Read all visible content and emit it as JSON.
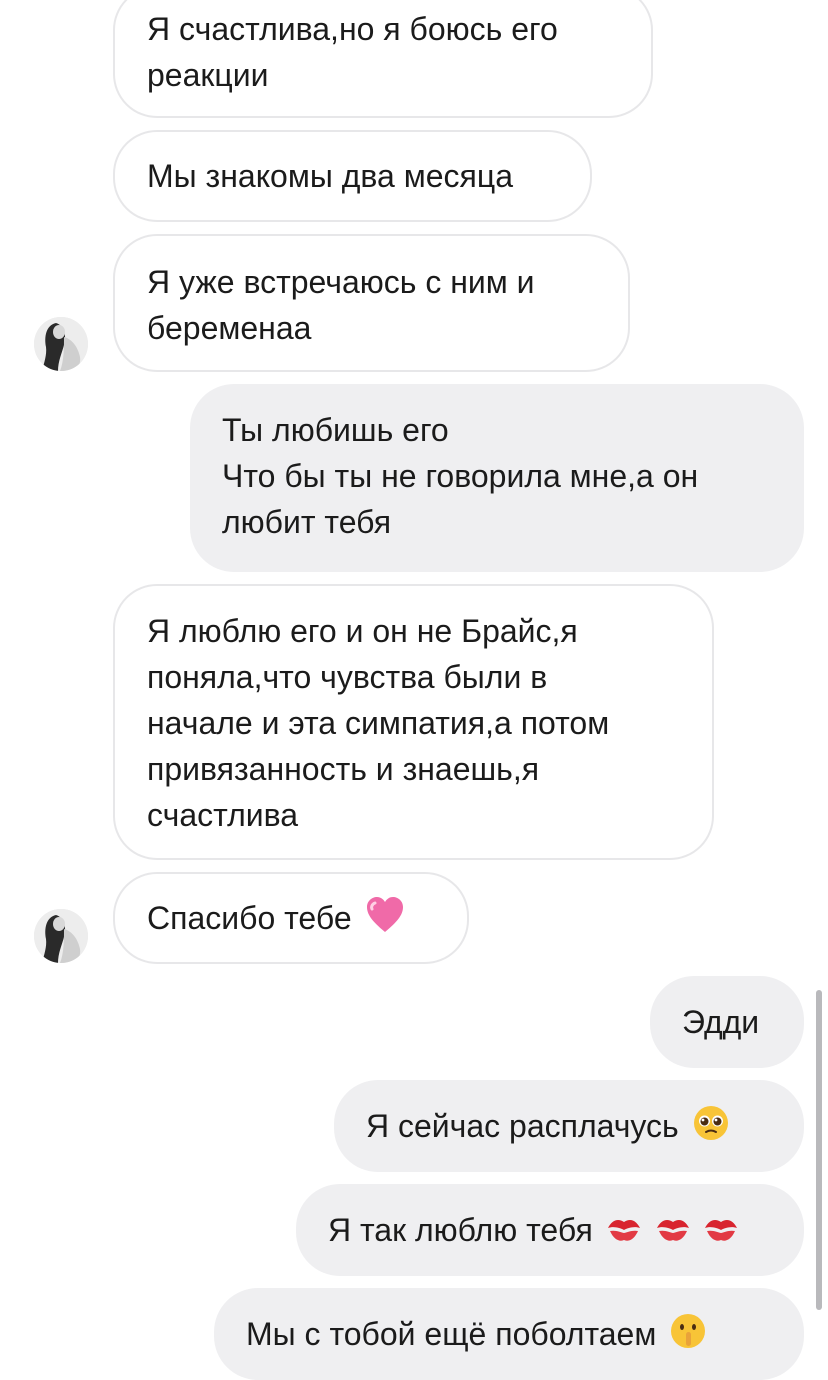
{
  "messages": [
    {
      "side": "in",
      "lines": [
        "Я счастлива,но я боюсь его",
        "реакции"
      ]
    },
    {
      "side": "in",
      "lines": [
        "Мы знакомы два месяца"
      ]
    },
    {
      "side": "in",
      "lines": [
        "Я уже встречаюсь с ним и",
        "беременаа"
      ]
    },
    {
      "side": "out",
      "lines": [
        "Ты любишь его",
        "Что бы ты не говорила мне,а он",
        "любит тебя"
      ]
    },
    {
      "side": "in",
      "lines": [
        "Я люблю его и он не Брайс,я",
        "поняла,что чувства были в",
        "начале и эта симпатия,а потом",
        "привязанность и знаешь,я",
        "счастлива"
      ]
    },
    {
      "side": "in",
      "lines": [
        "Спасибо тебе"
      ],
      "emoji": "pink-heart"
    },
    {
      "side": "out",
      "lines": [
        "Эдди"
      ]
    },
    {
      "side": "out",
      "lines": [
        "Я сейчас расплачусь"
      ],
      "emoji": "pleading-face"
    },
    {
      "side": "out",
      "lines": [
        "Я так люблю тебя"
      ],
      "emoji": "kiss-marks"
    },
    {
      "side": "out",
      "lines": [
        "Мы с тобой ещё поболтаем"
      ],
      "emoji": "shushing-face"
    }
  ],
  "colors": {
    "outgoing_bubble": "#efeff1",
    "incoming_border": "#e7e7e9",
    "text": "#1b1b1b"
  }
}
